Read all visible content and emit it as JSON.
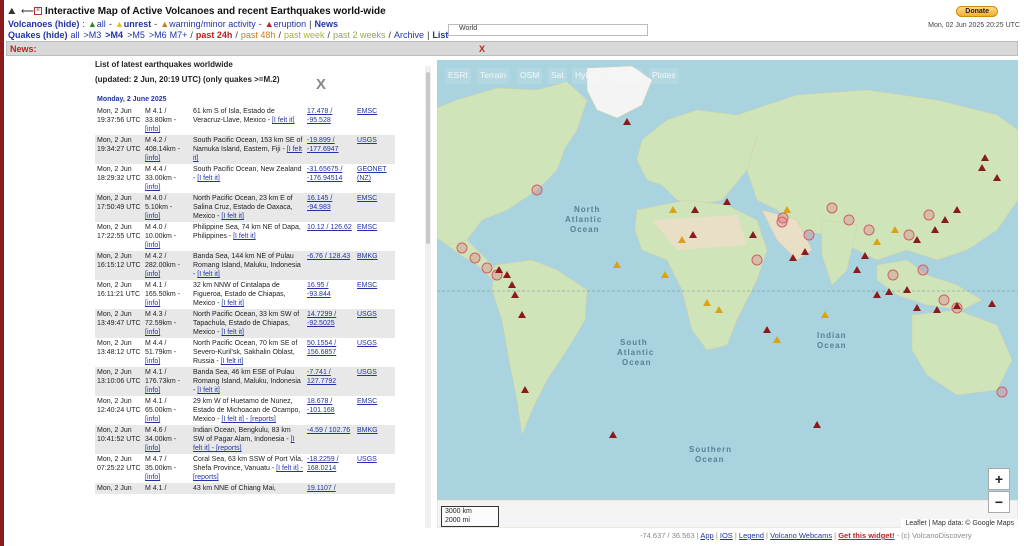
{
  "header": {
    "title": "Interactive Map of Active Volcanoes and recent Earthquakes world-wide",
    "donate_label": "Donate",
    "volcanoes_label": "Volcanoes (hide)",
    "all_label": "all",
    "unrest_label": "unrest",
    "warning_label": "warning/minor activity",
    "eruption_label": "eruption",
    "news_label": "News",
    "quakes_label": "Quakes (hide)",
    "quake_filters": [
      "all",
      ">M3",
      ">M4",
      ">M5",
      ">M6",
      "M7+"
    ],
    "time_filters": [
      "past 24h",
      "past 48h",
      "past week",
      "past 2 weeks"
    ],
    "archive_label": "Archive",
    "list_label": "List",
    "search_value": "World",
    "datetime": "Mon, 02 Jun 2025 20:25 UTC"
  },
  "newsbar": {
    "label": "News:",
    "close": "X"
  },
  "list": {
    "title": "List of latest earthquakes worldwide",
    "updated": "(updated: 2 Jun, 20:19 UTC) (only quakes >=M.2)",
    "close": "X",
    "day_header": "Monday, 2 June 2025",
    "quakes": [
      {
        "time": "Mon, 2 Jun 19:37:56 UTC",
        "mag": "M 4.1 / 33.80km -",
        "info": "[info]",
        "loc": "61 km S of Isla, Estado de Veracruz-Llave, Mexico -",
        "felt": "[I felt it]",
        "coords": "17.478 / -95.528",
        "src": "EMSC"
      },
      {
        "time": "Mon, 2 Jun 19:34:27 UTC",
        "mag": "M 4.2 / 408.14km -",
        "info": "[info]",
        "loc": "South Pacific Ocean, 153 km SE of Namuka Island, Eastern, Fiji -",
        "felt": "[I felt it]",
        "coords": "-19.899 / -177.6947",
        "src": "USGS"
      },
      {
        "time": "Mon, 2 Jun 18:29:32 UTC",
        "mag": "M 4.4 / 33.00km -",
        "info": "[info]",
        "loc": "South Pacific Ocean, New Zealand -",
        "felt": "[I felt it]",
        "coords": "-31.65675 / -176.94514",
        "src": "GEONET (NZ)"
      },
      {
        "time": "Mon, 2 Jun 17:50:49 UTC",
        "mag": "M 4.0 / 5.10km -",
        "info": "[info]",
        "loc": "North Pacific Ocean, 23 km E of Salina Cruz, Estado de Oaxaca, Mexico -",
        "felt": "[I felt it]",
        "coords": "16.145 / -94.983",
        "src": "EMSC"
      },
      {
        "time": "Mon, 2 Jun 17:22:55 UTC",
        "mag": "M 4.0 / 10.00km -",
        "info": "[info]",
        "loc": "Philippine Sea, 74 km NE of Dapa, Philippines -",
        "felt": "[I felt it]",
        "coords": "10.12 / 126.62",
        "src": "EMSC"
      },
      {
        "time": "Mon, 2 Jun 16:15:12 UTC",
        "mag": "M 4.2 / 282.00km -",
        "info": "[info]",
        "loc": "Banda Sea, 144 km NE of Pulau Romang Island, Maluku, Indonesia -",
        "felt": "[I felt it]",
        "coords": "-6.76 / 128.43",
        "src": "BMKG"
      },
      {
        "time": "Mon, 2 Jun 16:11:21 UTC",
        "mag": "M 4.1 / 165.50km -",
        "info": "[info]",
        "loc": "32 km NNW of Cintalapa de Figueroa, Estado de Chiapas, Mexico -",
        "felt": "[I felt it]",
        "coords": "16.95 / -93.844",
        "src": "EMSC"
      },
      {
        "time": "Mon, 2 Jun 13:49:47 UTC",
        "mag": "M 4.3 / 72.59km -",
        "info": "[info]",
        "loc": "North Pacific Ocean, 33 km SW of Tapachula, Estado de Chiapas, Mexico -",
        "felt": "[I felt it]",
        "coords": "14.7299 / -92.5025",
        "src": "USGS"
      },
      {
        "time": "Mon, 2 Jun 13:48:12 UTC",
        "mag": "M 4.4 / 51.79km -",
        "info": "[info]",
        "loc": "North Pacific Ocean, 70 km SE of Severo-Kuril'sk, Sakhalin Oblast, Russia -",
        "felt": "[I felt it]",
        "coords": "50.1554 / 156.6857",
        "src": "USGS"
      },
      {
        "time": "Mon, 2 Jun 13:10:06 UTC",
        "mag": "M 4.1 / 176.73km -",
        "info": "[info]",
        "loc": "Banda Sea, 46 km ESE of Pulau Romang Island, Maluku, Indonesia -",
        "felt": "[I felt it]",
        "coords": "-7.741 / 127.7792",
        "src": "USGS"
      },
      {
        "time": "Mon, 2 Jun 12:40:24 UTC",
        "mag": "M 4.1 / 65.00km -",
        "info": "[info]",
        "loc": "29 km W of Huetamo de Nunez, Estado de Michoacan de Ocampo, Mexico -",
        "felt": "[I felt it] - [reports]",
        "coords": "18.678 / -101.168",
        "src": "EMSC"
      },
      {
        "time": "Mon, 2 Jun 10:41:52 UTC",
        "mag": "M 4.6 / 34.00km -",
        "info": "[info]",
        "loc": "Indian Ocean, Bengkulu, 83 km SW of Pagar Alam, Indonesia -",
        "felt": "[I felt it] - [reports]",
        "coords": "-4.59 / 102.76",
        "src": "BMKG"
      },
      {
        "time": "Mon, 2 Jun 07:25:22 UTC",
        "mag": "M 4.7 / 35.00km -",
        "info": "[info]",
        "loc": "Coral Sea, 63 km SSW of Port Vila, Shefa Province, Vanuatu -",
        "felt": "[I felt it] - [reports]",
        "coords": "-18.2259 / 168.0214",
        "src": "USGS"
      },
      {
        "time": "Mon, 2 Jun",
        "mag": "M 4.1 /",
        "info": "",
        "loc": "43 km NNE of Chiang Mai,",
        "felt": "",
        "coords": "19.1107 /",
        "src": ""
      }
    ]
  },
  "map": {
    "layers": [
      "ESRI",
      "Terrain",
      "OSM",
      "Sat",
      "Hybrid",
      "Streets",
      "Plates"
    ],
    "zoom_in": "+",
    "zoom_out": "−",
    "scale_km": "3000 km",
    "scale_mi": "2000 mi",
    "attribution": "Leaflet | Map data: © Google Maps",
    "oceans": [
      "North Atlantic Ocean",
      "South Atlantic Ocean",
      "Indian Ocean",
      "Southern Ocean"
    ],
    "colors": {
      "ocean": "#a9d3df",
      "land": "#cfe4b8",
      "desert": "#e8dfc6",
      "ice": "#f4f4f4",
      "eruption": "#8b1a1a",
      "warning": "#d9a316",
      "quake": "#d0606a"
    }
  },
  "footer": {
    "coords": "-74.637 / 36.563",
    "links": [
      "App",
      "IOS",
      "Legend",
      "Volcano Webcams"
    ],
    "widget": "Get this widget!",
    "copyright": "- (c) VolcanoDiscovery"
  }
}
